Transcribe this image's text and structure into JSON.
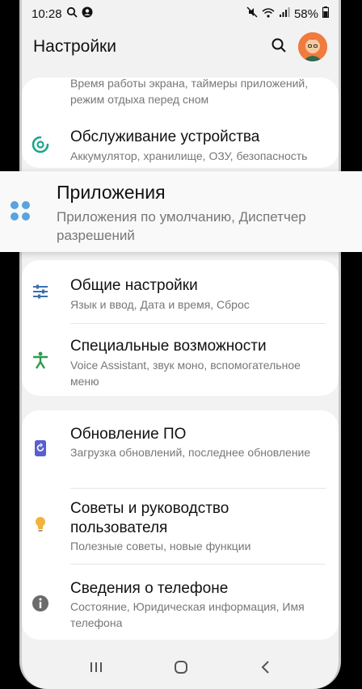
{
  "status_bar": {
    "time": "10:28",
    "battery": "58%",
    "left_icons": [
      "search-icon",
      "account-circle-icon"
    ],
    "right_icons": [
      "mute-icon",
      "wifi-icon",
      "signal-icon",
      "battery-icon"
    ]
  },
  "header": {
    "title": "Настройки",
    "search_icon": "search-icon",
    "avatar_icon": "avatar"
  },
  "top_card": {
    "partial_item_subtitle": "Время работы экрана, таймеры приложений, режим отдыха перед сном",
    "item": {
      "title": "Обслуживание устройства",
      "subtitle": "Аккумулятор, хранилище, ОЗУ, безопасность",
      "icon": "device-care-icon",
      "icon_color": "#1aa58a"
    }
  },
  "highlighted_item": {
    "title": "Приложения",
    "subtitle": "Приложения по умолчанию, Диспетчер разрешений",
    "icon": "apps-icon",
    "icon_color": "#5aa3e0"
  },
  "general_card": {
    "items": [
      {
        "title": "Общие настройки",
        "subtitle": "Язык и ввод, Дата и время, Сброс",
        "icon": "sliders-icon",
        "icon_color": "#3b6fb0"
      },
      {
        "title": "Специальные возможности",
        "subtitle": "Voice Assistant, звук моно, вспомогательное меню",
        "icon": "accessibility-icon",
        "icon_color": "#2c9b4a"
      }
    ]
  },
  "support_card": {
    "items": [
      {
        "title": "Обновление ПО",
        "subtitle": "Загрузка обновлений, последнее обновление",
        "icon": "software-update-icon",
        "icon_color": "#5a5fd0"
      },
      {
        "title": "Советы и руководство пользователя",
        "subtitle": "Полезные советы, новые функции",
        "icon": "lightbulb-icon",
        "icon_color": "#f2b33a"
      },
      {
        "title": "Сведения о телефоне",
        "subtitle": "Состояние, Юридическая информация, Имя телефона",
        "icon": "info-icon",
        "icon_color": "#6b6b6b"
      }
    ]
  },
  "nav_bar": {
    "buttons": [
      "recents-icon",
      "home-icon",
      "back-icon"
    ]
  }
}
